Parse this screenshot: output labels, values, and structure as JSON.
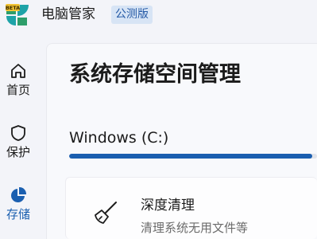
{
  "app": {
    "title": "电脑管家",
    "badge": "公测版",
    "logo_badge_text": "BETA"
  },
  "sidebar": {
    "items": [
      {
        "label": "首页",
        "icon": "home-icon",
        "active": false
      },
      {
        "label": "保护",
        "icon": "shield-icon",
        "active": false
      },
      {
        "label": "存储",
        "icon": "pie-chart-icon",
        "active": true
      }
    ]
  },
  "main": {
    "title": "系统存储空间管理",
    "drive": {
      "label": "Windows (C:)",
      "used_fraction": 0.98
    },
    "cards": [
      {
        "title": "深度清理",
        "subtitle": "清理系统无用文件等",
        "icon": "broom-icon"
      }
    ]
  },
  "colors": {
    "accent": "#1b5fb0",
    "badge_bg": "#d7e4f5",
    "logo_green": "#2e9e6b",
    "logo_teal": "#1ea3a8"
  }
}
